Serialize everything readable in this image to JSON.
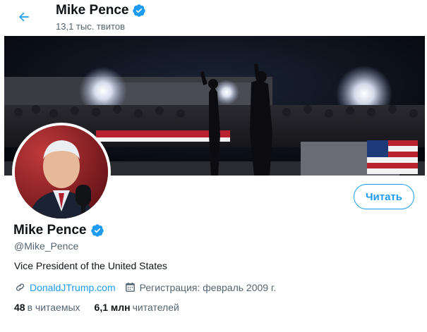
{
  "header": {
    "name": "Mike Pence",
    "tweet_count": "13,1 тыс. твитов",
    "back_icon": "arrow-left-icon"
  },
  "profile": {
    "name": "Mike Pence",
    "handle": "@Mike_Pence",
    "bio": "Vice President of the United States",
    "website": "DonaldJTrump.com",
    "joined": "Регистрация: февраль 2009 г.",
    "verified_icon": "verified-badge-icon"
  },
  "actions": {
    "follow_label": "Читать"
  },
  "stats": {
    "following_count": "48",
    "following_label": "в читаемых",
    "followers_count": "6,1 млн",
    "followers_label": "читателей"
  },
  "colors": {
    "accent": "#1d9bf0",
    "text": "#0f1419",
    "secondary": "#536471"
  }
}
